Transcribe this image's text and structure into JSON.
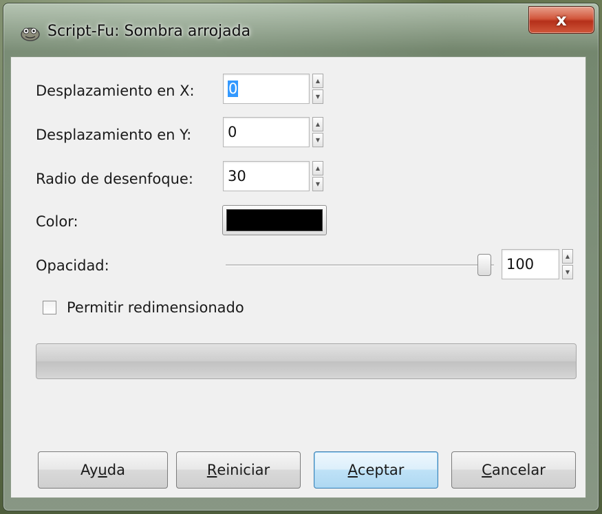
{
  "window": {
    "title": "Script-Fu: Sombra arrojada",
    "close_glyph": "x"
  },
  "fields": {
    "offset_x": {
      "label": "Desplazamiento en X:",
      "value": "0"
    },
    "offset_y": {
      "label": "Desplazamiento en Y:",
      "value": "0"
    },
    "blur_radius": {
      "label": "Radio de desenfoque:",
      "value": "30"
    },
    "color": {
      "label": "Color:",
      "value": "#000000"
    },
    "opacity": {
      "label": "Opacidad:",
      "value": "100",
      "fraction": 1.0
    },
    "allow_resize": {
      "label": "Permitir redimensionado",
      "checked": false
    }
  },
  "buttons": {
    "help": {
      "before": "Ay",
      "mnemonic": "u",
      "after": "da"
    },
    "reset": {
      "before": "",
      "mnemonic": "R",
      "after": "einiciar"
    },
    "ok": {
      "before": "",
      "mnemonic": "A",
      "after": "ceptar"
    },
    "cancel": {
      "before": "",
      "mnemonic": "C",
      "after": "ancelar"
    }
  },
  "progress": {
    "fraction": 0
  }
}
